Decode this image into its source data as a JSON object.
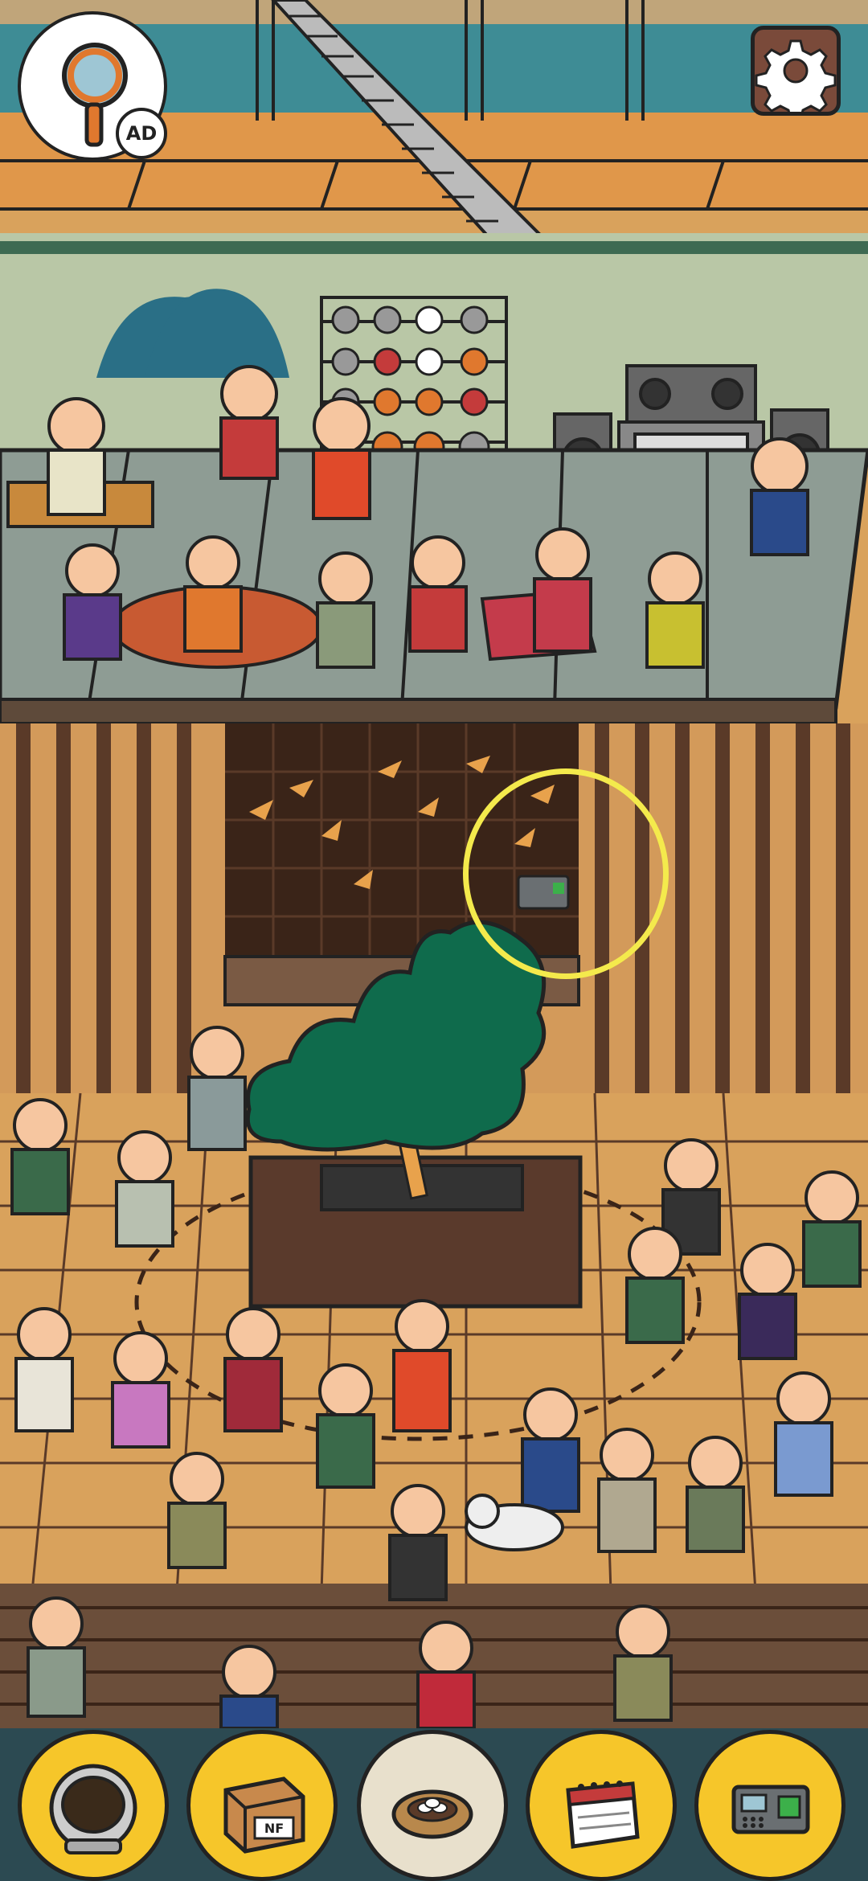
{
  "hint": {
    "badge": "AD",
    "icon": "magnifier-icon"
  },
  "settings": {
    "icon": "gear-icon"
  },
  "target": {
    "item": "card-reader",
    "color": "#f4ea4c"
  },
  "tray": [
    {
      "icon": "astronaut-helmet-icon",
      "found": false
    },
    {
      "icon": "nf-package-box-icon",
      "found": false
    },
    {
      "icon": "bird-nest-icon",
      "found": true
    },
    {
      "icon": "desk-calendar-icon",
      "found": false
    },
    {
      "icon": "card-reader-icon",
      "found": false
    }
  ],
  "colors": {
    "slot": "#f6c62a",
    "slot_found": "#e8e0cc",
    "tray_bg": "#2c4a52",
    "floor": "#d9a25c",
    "wall_dark": "#3a2418",
    "platform": "#8e9c94",
    "tree": "#0f6b4c"
  }
}
